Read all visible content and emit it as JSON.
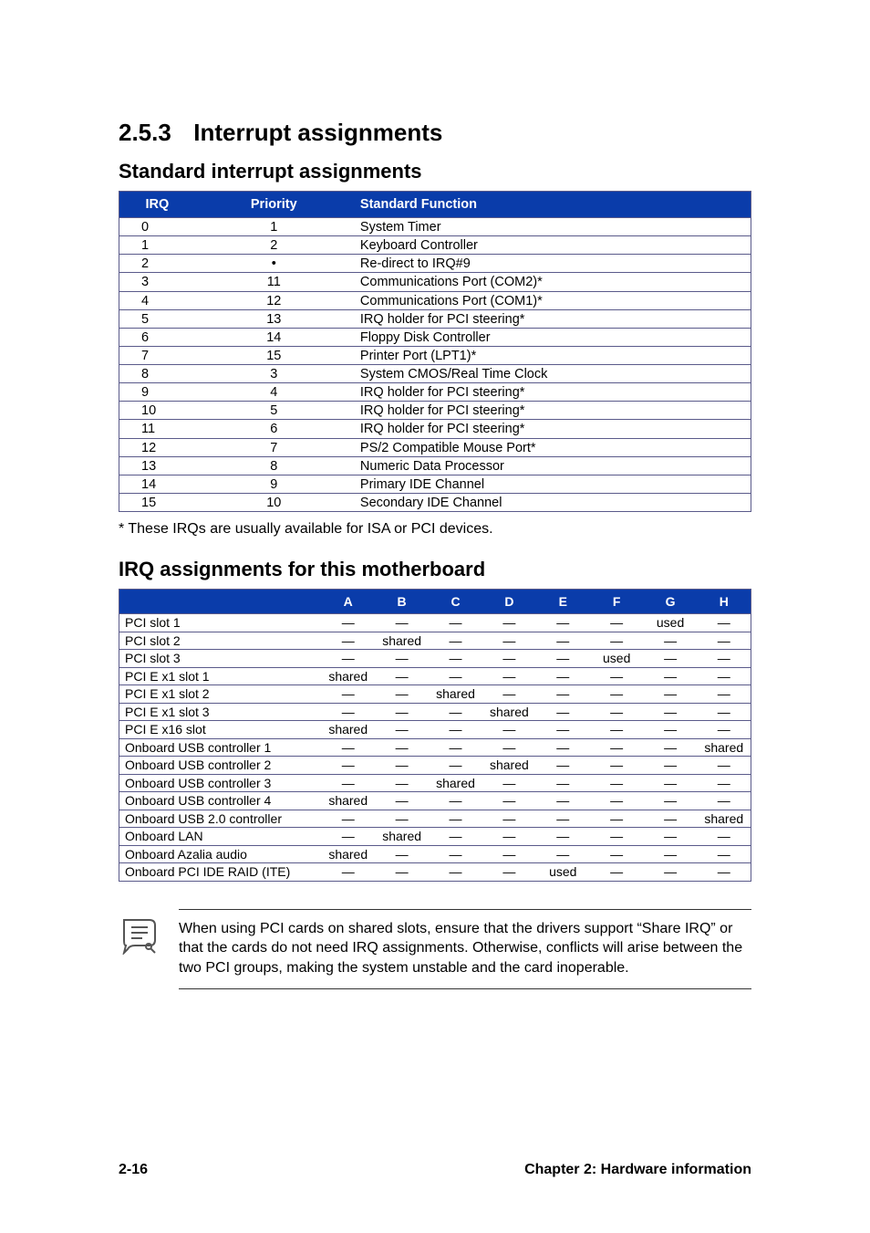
{
  "section": {
    "number": "2.5.3",
    "title": "Interrupt assignments"
  },
  "sub1_title": "Standard interrupt assignments",
  "table1": {
    "headers": {
      "irq": "IRQ",
      "priority": "Priority",
      "func": "Standard Function"
    },
    "rows": [
      {
        "irq": "0",
        "priority": "1",
        "func": "System Timer"
      },
      {
        "irq": "1",
        "priority": "2",
        "func": "Keyboard Controller"
      },
      {
        "irq": "2",
        "priority": "•",
        "func": "Re-direct to IRQ#9"
      },
      {
        "irq": "3",
        "priority": "11",
        "func": "Communications Port (COM2)*"
      },
      {
        "irq": "4",
        "priority": "12",
        "func": "Communications Port (COM1)*"
      },
      {
        "irq": "5",
        "priority": "13",
        "func": "IRQ holder for PCI steering*"
      },
      {
        "irq": "6",
        "priority": "14",
        "func": "Floppy Disk Controller"
      },
      {
        "irq": "7",
        "priority": "15",
        "func": "Printer Port (LPT1)*"
      },
      {
        "irq": "8",
        "priority": "3",
        "func": "System CMOS/Real Time Clock"
      },
      {
        "irq": "9",
        "priority": "4",
        "func": "IRQ holder for PCI steering*"
      },
      {
        "irq": "10",
        "priority": "5",
        "func": "IRQ holder for PCI steering*"
      },
      {
        "irq": "11",
        "priority": "6",
        "func": "IRQ holder for PCI steering*"
      },
      {
        "irq": "12",
        "priority": "7",
        "func": "PS/2 Compatible Mouse Port*"
      },
      {
        "irq": "13",
        "priority": "8",
        "func": "Numeric Data Processor"
      },
      {
        "irq": "14",
        "priority": "9",
        "func": "Primary IDE Channel"
      },
      {
        "irq": "15",
        "priority": "10",
        "func": "Secondary IDE Channel"
      }
    ]
  },
  "footnote1": "* These IRQs are usually available for ISA or PCI devices.",
  "sub2_title": "IRQ assignments for this motherboard",
  "table2": {
    "headers": [
      "",
      "A",
      "B",
      "C",
      "D",
      "E",
      "F",
      "G",
      "H"
    ],
    "rows": [
      {
        "label": "PCI slot 1",
        "cells": [
          "—",
          "—",
          "—",
          "—",
          "—",
          "—",
          "used",
          "—"
        ]
      },
      {
        "label": "PCI slot 2",
        "cells": [
          "—",
          "shared",
          "—",
          "—",
          "—",
          "—",
          "—",
          "—"
        ]
      },
      {
        "label": "PCI slot 3",
        "cells": [
          "—",
          "—",
          "—",
          "—",
          "—",
          "used",
          "—",
          "—"
        ]
      },
      {
        "label": "PCI E x1 slot 1",
        "cells": [
          "shared",
          "—",
          "—",
          "—",
          "—",
          "—",
          "—",
          "—"
        ]
      },
      {
        "label": "PCI E x1 slot 2",
        "cells": [
          "—",
          "—",
          "shared",
          "—",
          "—",
          "—",
          "—",
          "—"
        ]
      },
      {
        "label": "PCI E x1 slot 3",
        "cells": [
          "—",
          "—",
          "—",
          "shared",
          "—",
          "—",
          "—",
          "—"
        ]
      },
      {
        "label": "PCI E x16 slot",
        "cells": [
          "shared",
          "—",
          "—",
          "—",
          "—",
          "—",
          "—",
          "—"
        ]
      },
      {
        "label": "Onboard USB controller 1",
        "cells": [
          "—",
          "—",
          "—",
          "—",
          "—",
          "—",
          "—",
          "shared"
        ]
      },
      {
        "label": "Onboard USB controller 2",
        "cells": [
          "—",
          "—",
          "—",
          "shared",
          "—",
          "—",
          "—",
          "—"
        ]
      },
      {
        "label": "Onboard USB controller 3",
        "cells": [
          "—",
          "—",
          "shared",
          "—",
          "—",
          "—",
          "—",
          "—"
        ]
      },
      {
        "label": "Onboard USB controller 4",
        "cells": [
          "shared",
          "—",
          "—",
          "—",
          "—",
          "—",
          "—",
          "—"
        ]
      },
      {
        "label": "Onboard USB 2.0 controller",
        "cells": [
          "—",
          "—",
          "—",
          "—",
          "—",
          "—",
          "—",
          "shared"
        ]
      },
      {
        "label": "Onboard LAN",
        "cells": [
          "—",
          "shared",
          "—",
          "—",
          "—",
          "—",
          "—",
          "—"
        ]
      },
      {
        "label": "Onboard Azalia audio",
        "cells": [
          "shared",
          "—",
          "—",
          "—",
          "—",
          "—",
          "—",
          "—"
        ]
      },
      {
        "label": "Onboard PCI IDE RAID (ITE)",
        "cells": [
          "—",
          "—",
          "—",
          "—",
          "used",
          "—",
          "—",
          "—"
        ]
      }
    ]
  },
  "notebox": "When using PCI cards on shared slots, ensure that the drivers support “Share IRQ” or that the cards do not need IRQ assignments. Otherwise, conflicts will arise between the two PCI groups, making the system unstable and the card inoperable.",
  "footer": {
    "left": "2-16",
    "right": "Chapter 2: Hardware information"
  }
}
